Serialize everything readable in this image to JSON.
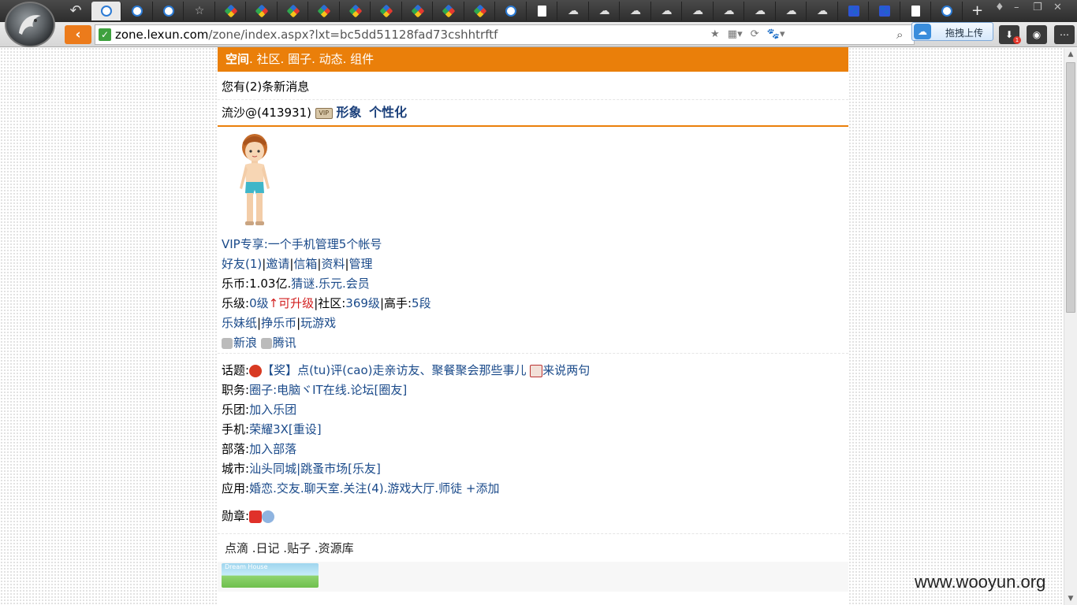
{
  "browser": {
    "tabs": [
      "active-e",
      "e",
      "e",
      "star",
      "multi",
      "multi",
      "multi",
      "multi",
      "multi",
      "multi",
      "multi",
      "multi",
      "multi",
      "e",
      "doc",
      "cloud",
      "cloud",
      "cloud",
      "cloud",
      "cloud",
      "cloud",
      "cloud",
      "cloud",
      "cloud",
      "paw",
      "paw",
      "doc",
      "e"
    ],
    "new_tab": "+",
    "url_host": "zone.lexun.com",
    "url_rest": "/zone/index.aspx?lxt=bc5dd51128fad73cshhtrftf",
    "upload_label": "拖拽上传",
    "download_badge": "1"
  },
  "page": {
    "topnav": {
      "space": "空间",
      "links": ". 社区. 圈子. 动态. 组件"
    },
    "messages": "您有(2)条新消息",
    "user": {
      "name": "流沙@(413931)",
      "vip_icon_text": "VIP",
      "image": "形象",
      "personalize": "个性化"
    },
    "profile": {
      "vip_label": "VIP专享:",
      "vip_link": "一个手机管理5个帐号",
      "friends": "好友(1)",
      "invite": "邀请",
      "mailbox": "信箱",
      "info": "资料",
      "manage": "管理",
      "coins_label": "乐币:",
      "coins_value": "1.03亿.",
      "coins_links": "猜谜.乐元.会员",
      "level_label": "乐级:",
      "level_value": "0级",
      "level_up": "↑可升级",
      "community": "|社区:",
      "community_level": "369级",
      "expert": "|高手:",
      "expert_level": "5段",
      "sister": "乐妹纸",
      "earn": "挣乐币",
      "play": "玩游戏",
      "sina": "新浪",
      "tencent": "腾讯"
    },
    "details": {
      "topic_label": "话题:",
      "topic_text": "【奖】点(tu)评(cao)走亲访友、聚餐聚会那些事儿",
      "topic_say": "来说两句",
      "job_label": "职务:",
      "job_text": "圈子:电脑ヾIT在线.论坛[圈友]",
      "band_label": "乐团:",
      "band_text": "加入乐团",
      "phone_label": "手机:",
      "phone_text": "荣耀3X[重设]",
      "tribe_label": "部落:",
      "tribe_text": "加入部落",
      "city_label": "城市:",
      "city_text": "汕头同城|跳蚤市场[乐友]",
      "app_label": "应用:",
      "app_text": "婚恋.交友.聊天室.关注(4).游戏大厅.师徒 +添加",
      "medal_label": "勋章:"
    },
    "subtabs": "点滴 .日记 .贴子 .资源库",
    "banner_text": "Dream House"
  },
  "watermark": "www.wooyun.org",
  "colors": {
    "accent": "#ea7f0a",
    "link": "#1a4a8a",
    "level_up": "#d21f1f"
  }
}
